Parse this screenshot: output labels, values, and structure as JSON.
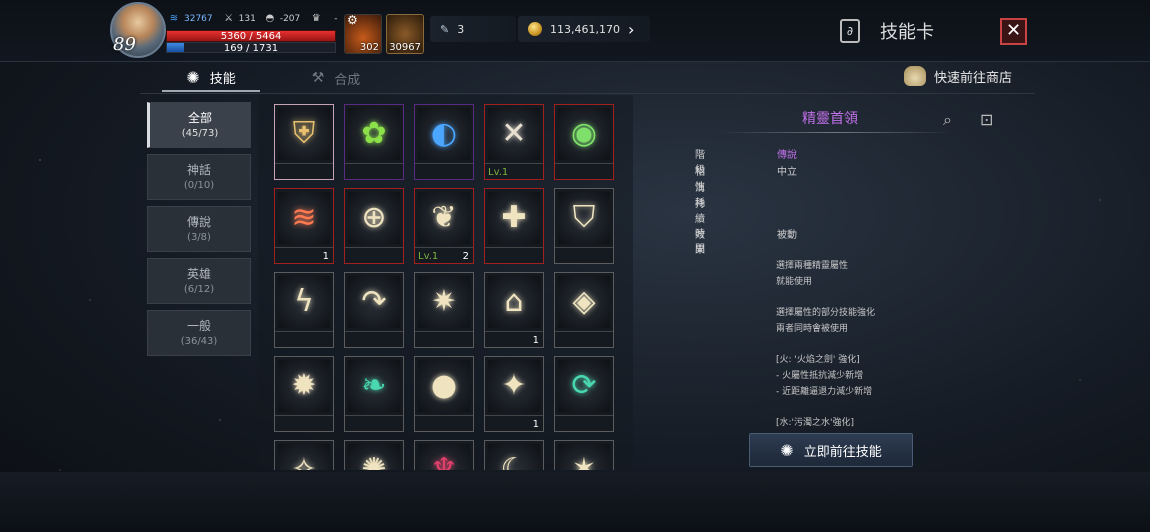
{
  "player": {
    "level": "89",
    "stat1": "32767",
    "stat2": "131",
    "stat3": "-207",
    "stat4": "-",
    "hp": "5360 / 5464",
    "mp": "169 / 1731",
    "hp_fraction": 0.98,
    "mp_fraction": 0.1
  },
  "slots": [
    {
      "icon": "potion-icon",
      "count": "302"
    },
    {
      "icon": "feather-icon",
      "count": "30967"
    }
  ],
  "currency": {
    "item_count": "3",
    "gold": "113,461,170"
  },
  "header": {
    "title": "技能卡",
    "close": "✕"
  },
  "tabs": [
    {
      "label": "技能",
      "active": true
    },
    {
      "label": "合成",
      "active": false
    }
  ],
  "shop_link": "快速前往商店",
  "categories": [
    {
      "label": "全部",
      "count": "(45/73)",
      "active": true
    },
    {
      "label": "神話",
      "count": "(0/10)",
      "active": false
    },
    {
      "label": "傳說",
      "count": "(3/8)",
      "active": false
    },
    {
      "label": "英雄",
      "count": "(6/12)",
      "active": false
    },
    {
      "label": "一般",
      "count": "(36/43)",
      "active": false
    }
  ],
  "cards": [
    {
      "grade": "mythic",
      "icon": "shield-elements-icon",
      "color": "#e8c070",
      "lv": "",
      "num": ""
    },
    {
      "grade": "epic",
      "icon": "venus-flytrap-icon",
      "color": "#8ce04a",
      "lv": "",
      "num": ""
    },
    {
      "grade": "epic",
      "icon": "blue-dragon-icon",
      "color": "#4aa6ff",
      "lv": "",
      "num": ""
    },
    {
      "grade": "legend",
      "icon": "crossed-arrows-icon",
      "color": "#e8e0d0",
      "lv": "Lv.1",
      "num": ""
    },
    {
      "grade": "legend",
      "icon": "green-signal-icon",
      "color": "#7ee06a",
      "lv": "",
      "num": ""
    },
    {
      "grade": "legend",
      "icon": "claw-slash-icon",
      "color": "#ff7a50",
      "lv": "",
      "num": "1"
    },
    {
      "grade": "legend",
      "icon": "target-sight-icon",
      "color": "#f0e4c0",
      "lv": "",
      "num": ""
    },
    {
      "grade": "legend",
      "icon": "wing-icon",
      "color": "#f0e4c0",
      "lv": "Lv.1",
      "num": "2"
    },
    {
      "grade": "legend",
      "icon": "heal-plus-icon",
      "color": "#f0e4c0",
      "lv": "",
      "num": ""
    },
    {
      "grade": "normal",
      "icon": "shield-icon",
      "color": "#f0e4c0",
      "lv": "",
      "num": ""
    },
    {
      "grade": "normal",
      "icon": "lightning-icon",
      "color": "#f0e4c0",
      "lv": "",
      "num": ""
    },
    {
      "grade": "normal",
      "icon": "curved-arrow-icon",
      "color": "#f0e4c0",
      "lv": "",
      "num": ""
    },
    {
      "grade": "normal",
      "icon": "burst-icon",
      "color": "#f0e4c0",
      "lv": "",
      "num": ""
    },
    {
      "grade": "normal",
      "icon": "sparkle-altar-icon",
      "color": "#f0e4c0",
      "lv": "",
      "num": "1"
    },
    {
      "grade": "normal",
      "icon": "eye-icon",
      "color": "#f0e4c0",
      "lv": "",
      "num": ""
    },
    {
      "grade": "normal",
      "icon": "spiky-beast-icon",
      "color": "#f0e4c0",
      "lv": "",
      "num": ""
    },
    {
      "grade": "normal",
      "icon": "green-leaf-icon",
      "color": "#4ad8b0",
      "lv": "",
      "num": ""
    },
    {
      "grade": "normal",
      "icon": "orb-pedestal-icon",
      "color": "#f0e4c0",
      "lv": "",
      "num": ""
    },
    {
      "grade": "normal",
      "icon": "figure-icon",
      "color": "#f0e4c0",
      "lv": "",
      "num": "1"
    },
    {
      "grade": "normal",
      "icon": "cycle-arrows-icon",
      "color": "#4ad8b0",
      "lv": "",
      "num": ""
    },
    {
      "grade": "normal",
      "icon": "stars-icon",
      "color": "#f0e4c0",
      "lv": "",
      "num": ""
    },
    {
      "grade": "normal",
      "icon": "fireworks-icon",
      "color": "#f0e4c0",
      "lv": "",
      "num": ""
    },
    {
      "grade": "normal",
      "icon": "red-wing-icon",
      "color": "#e0406a",
      "lv": "",
      "num": ""
    },
    {
      "grade": "normal",
      "icon": "moon-icon",
      "color": "#f0e4c0",
      "lv": "",
      "num": ""
    },
    {
      "grade": "normal",
      "icon": "flame-icon",
      "color": "#f0e4c0",
      "lv": "",
      "num": ""
    }
  ],
  "detail": {
    "name": "精靈首領",
    "grade_label": "階級",
    "grade_value": "傳說",
    "grade_color": "#c070e8",
    "affinity_label": "相性",
    "affinity_value": "中立",
    "cost_label": "消耗",
    "duration_label": "持續時間",
    "effect_label": "效果",
    "effect_value": "被動",
    "lines": [
      "選擇兩種精靈屬性",
      "就能使用",
      "",
      "選擇屬性的部分技能強化",
      "兩者同時會被使用",
      "",
      "[火: '火焰之劍' 強化]",
      " - 火屬性抵抗減少新增",
      " - 近距離逼退力減少新增",
      "",
      "[水:'污濁之水'強化]"
    ],
    "goto_label": "立即前往技能"
  }
}
